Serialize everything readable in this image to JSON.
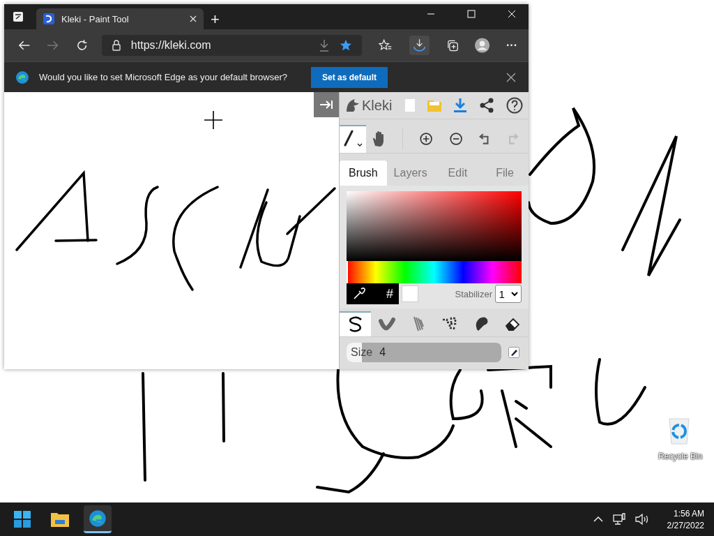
{
  "browser": {
    "tabs": [
      {
        "title": "Kleki - Paint Tool",
        "selected": true
      }
    ],
    "new_tab": "+",
    "address": "https://kleki.com",
    "menu": "···",
    "infobar": {
      "message": "Would you like to set Microsoft Edge as your default browser?",
      "button": "Set as default"
    }
  },
  "kleki": {
    "logo": "Kleki",
    "tools": [
      {
        "kind": "brush",
        "selected": true
      },
      {
        "kind": "hand",
        "selected": false
      }
    ],
    "tabs": [
      {
        "label": "Brush",
        "selected": true
      },
      {
        "label": "Layers",
        "selected": false
      },
      {
        "label": "Edit",
        "selected": false
      },
      {
        "label": "File",
        "selected": false
      }
    ],
    "hue": {
      "level": 0
    },
    "hex_symbol": "#",
    "stabilizer": {
      "label": "Stabilizer",
      "value": "1"
    },
    "brushes": [
      {
        "kind": "pen",
        "selected": true
      },
      {
        "kind": "blend",
        "selected": false
      },
      {
        "kind": "sketchy",
        "selected": false
      },
      {
        "kind": "pixel",
        "selected": false
      },
      {
        "kind": "smudge",
        "selected": false
      },
      {
        "kind": "eraser",
        "selected": false
      }
    ],
    "size": {
      "label": "Size",
      "value": "4",
      "level": 0.1
    }
  },
  "desktop": {
    "icons": [
      {
        "label": "Recycle Bin"
      }
    ]
  },
  "taskbar": {
    "apps": [
      {
        "kind": "start",
        "active": false
      },
      {
        "kind": "explorer",
        "active": false
      },
      {
        "kind": "edge",
        "active": true
      }
    ],
    "time": "1:56 AM",
    "date": "2/27/2022"
  }
}
